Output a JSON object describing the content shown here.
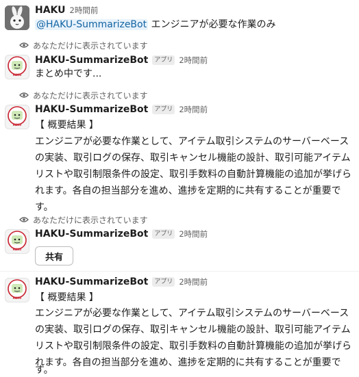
{
  "message1": {
    "sender": "HAKU",
    "time": "2時間前",
    "mention": "@HAKU-SummarizeBot",
    "text": "エンジニアが必要な作業のみ"
  },
  "bot_name": "HAKU-SummarizeBot",
  "app_badge": "アプリ",
  "notice_text": "あなただけに表示されています",
  "message2": {
    "time": "2時間前",
    "text": "まとめ中です..."
  },
  "message3": {
    "time": "2時間前",
    "heading": "【 概要結果 】",
    "lines": [
      "エンジニアが必要な作業として、アイテム取引システムのサーバーベース",
      "の実装、取引ログの保存、取引キャンセル機能の設計、取引可能アイテム",
      "リストや取引制限条件の設定、取引手数料の自動計算機能の追加が挙げら",
      "れます。各自の担当部分を進め、進捗を定期的に共有することが重要で",
      "す。"
    ]
  },
  "message4": {
    "time": "2時間前",
    "share_label": "共有"
  },
  "message5": {
    "time": "2時間前",
    "heading": "【 概要結果 】",
    "lines": [
      "エンジニアが必要な作業として、アイテム取引システムのサーバーベース",
      "の実装、取引ログの保存、取引キャンセル機能の設計、取引可能アイテム",
      "リストや取引制限条件の設定、取引手数料の自動計算機能の追加が挙げら",
      "れます。各自の担当部分を進め、進捗を定期的に共有することが重要で",
      "す。"
    ]
  },
  "icons": {
    "user_avatar": "rabbit-icon",
    "bot_avatar": "robot-icon",
    "notice": "eye-icon"
  },
  "colors": {
    "mention_bg": "#e8f2fb",
    "mention_text": "#1264a3",
    "bot_green": "#cfe9b8",
    "bot_red": "#c8202e"
  }
}
